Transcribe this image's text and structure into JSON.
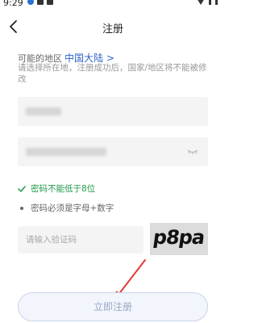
{
  "status_bar": {
    "time": "9:29"
  },
  "header": {
    "title": "注册",
    "back_icon": "chevron-left-icon"
  },
  "region": {
    "label": "可能的地区",
    "value": "中国大陆 >",
    "hint": "请选择所在地，注册成功后，国家/地区将不能被修改"
  },
  "password_rules": {
    "min_length": "密码不能低于8位",
    "composition": "密码必须是字母+数字"
  },
  "captcha": {
    "placeholder": "请输入验证码",
    "image_text": "p8pa"
  },
  "submit": {
    "label": "立即注册"
  },
  "colors": {
    "accent": "#2d62c9",
    "success": "#1f9a4a",
    "annotation_arrow": "#e53935"
  }
}
